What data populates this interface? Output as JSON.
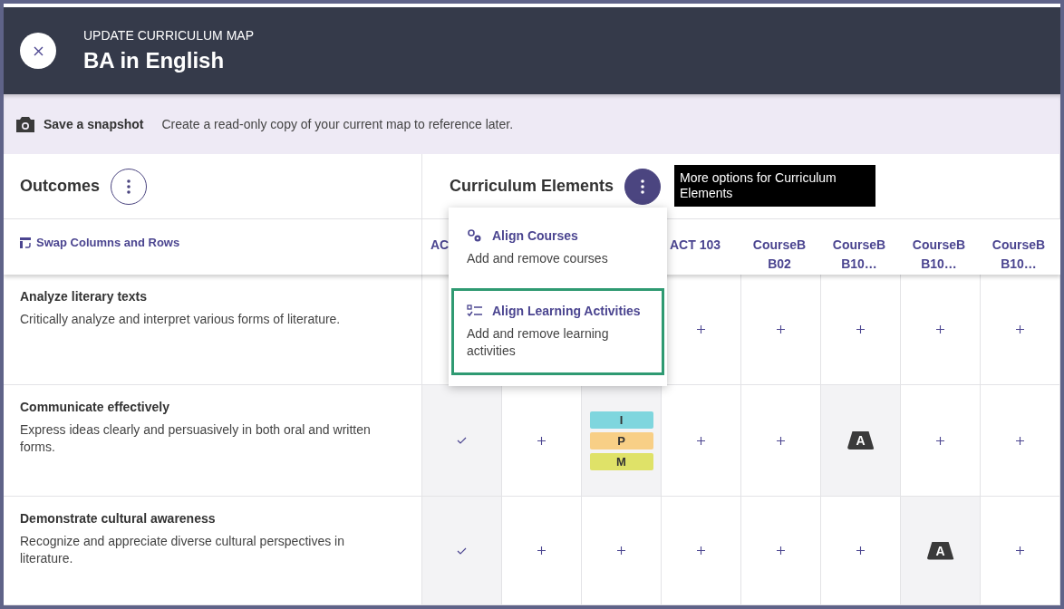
{
  "header": {
    "subtitle": "UPDATE CURRICULUM MAP",
    "title": "BA in English"
  },
  "snapshot": {
    "label": "Save a snapshot",
    "description": "Create a read-only copy of your current map to reference later."
  },
  "outcomes_panel": {
    "title": "Outcomes"
  },
  "elements_panel": {
    "title": "Curriculum Elements",
    "tooltip": "More options for Curriculum Elements"
  },
  "swap_link": "Swap Columns and Rows",
  "columns": [
    {
      "label": "AC"
    },
    {},
    {},
    {
      "label": "ACT 103"
    },
    {
      "label": "CourseB B02"
    },
    {
      "label": "CourseB B10…"
    },
    {
      "label": "CourseB B10…"
    },
    {
      "label": "CourseB B10…"
    }
  ],
  "menu": [
    {
      "kind": "courses",
      "title": "Align Courses",
      "description": "Add and remove courses",
      "selected": false
    },
    {
      "kind": "activities",
      "title": "Align Learning Activities",
      "description": "Add and remove learning activities",
      "selected": true
    }
  ],
  "rows": [
    {
      "title": "Analyze literary texts",
      "description": "Critically analyze and interpret various forms of literature.",
      "cells": [
        {},
        {},
        {},
        {
          "kind": "add"
        },
        {
          "kind": "add"
        },
        {
          "kind": "add"
        },
        {
          "kind": "add"
        },
        {
          "kind": "add"
        }
      ]
    },
    {
      "title": "Communicate effectively",
      "description": "Express ideas clearly and persuasively in both oral and written forms.",
      "cells": [
        {
          "kind": "check"
        },
        {
          "kind": "add"
        },
        {
          "kind": "levels",
          "tags": [
            {
              "label": "I",
              "color": "#7fd6de"
            },
            {
              "label": "P",
              "color": "#f8cf86"
            },
            {
              "label": "M",
              "color": "#dfe268"
            }
          ]
        },
        {
          "kind": "add"
        },
        {
          "kind": "add"
        },
        {
          "kind": "badge",
          "label": "A"
        },
        {
          "kind": "add"
        },
        {
          "kind": "add"
        }
      ]
    },
    {
      "title": "Demonstrate cultural awareness",
      "description": "Recognize and appreciate diverse cultural perspectives in literature.",
      "cells": [
        {
          "kind": "check"
        },
        {
          "kind": "add"
        },
        {
          "kind": "add"
        },
        {
          "kind": "add"
        },
        {
          "kind": "add"
        },
        {
          "kind": "add"
        },
        {
          "kind": "badge",
          "label": "A"
        },
        {
          "kind": "add"
        }
      ]
    }
  ]
}
